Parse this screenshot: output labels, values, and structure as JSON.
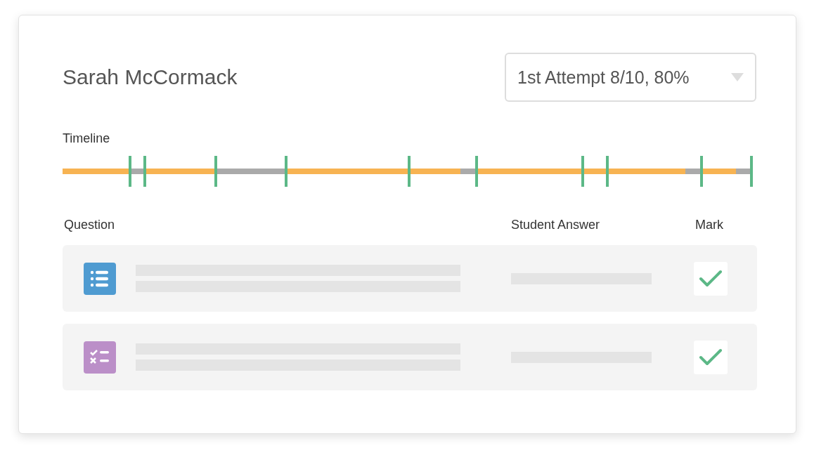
{
  "student": {
    "name": "Sarah McCormack"
  },
  "attempt_select": {
    "value": "1st Attempt 8/10, 80%"
  },
  "timeline": {
    "label": "Timeline"
  },
  "table": {
    "columns": [
      "Question",
      "Student Answer",
      "Mark"
    ],
    "rows": [
      {
        "kind": "list",
        "checked": true
      },
      {
        "kind": "checklist",
        "checked": true
      }
    ]
  }
}
